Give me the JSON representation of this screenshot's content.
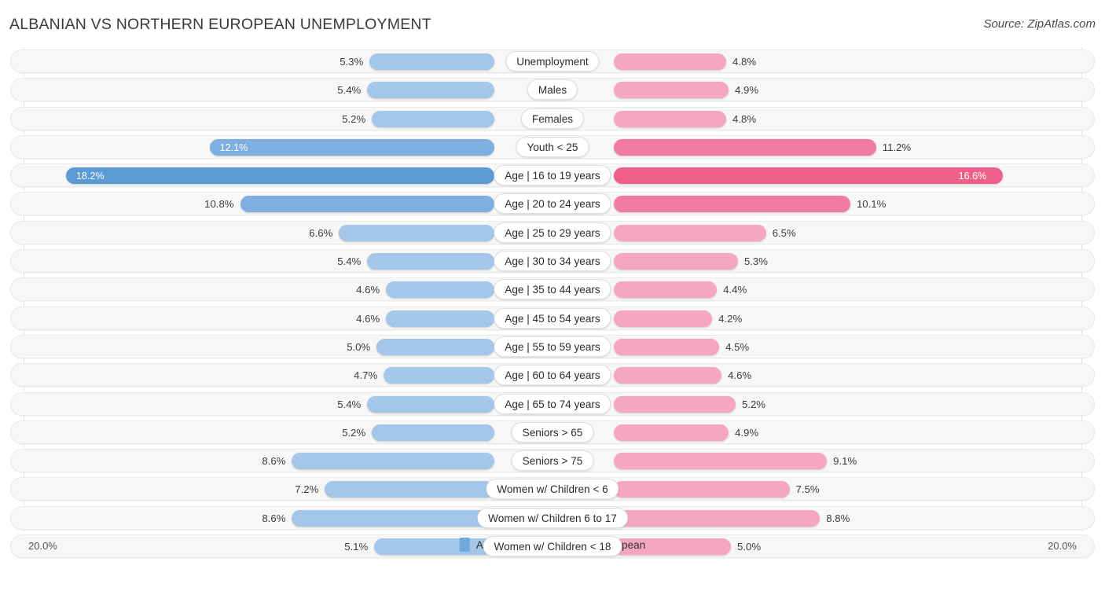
{
  "header": {
    "title": "ALBANIAN VS NORTHERN EUROPEAN UNEMPLOYMENT",
    "source": "Source: ZipAtlas.com"
  },
  "axis": {
    "left_label": "20.0%",
    "right_label": "20.0%",
    "max": 20.0
  },
  "legend": {
    "items": [
      {
        "label": "Albanian",
        "color": "#6fa8dc"
      },
      {
        "label": "Northern European",
        "color": "#ef5f8c"
      }
    ]
  },
  "colors": {
    "blue_light": "#a3c6e9",
    "blue_mid": "#7faee0",
    "blue_dark": "#5b9bd5",
    "pink_light": "#f6a6c0",
    "pink_mid": "#f27ba5",
    "pink_dark": "#ef5f8c",
    "track_bg": "#f7f7f7",
    "track_border": "#e9e9e9",
    "grid": "#e2e2e2"
  },
  "chart_data": {
    "type": "bar",
    "title": "ALBANIAN VS NORTHERN EUROPEAN UNEMPLOYMENT",
    "subtitle": "",
    "xlabel": "",
    "ylabel": "",
    "orientation": "horizontal-diverging",
    "unit": "%",
    "xlim": [
      0,
      20.0
    ],
    "grid": true,
    "legend_position": "bottom-center",
    "categories": [
      "Unemployment",
      "Males",
      "Females",
      "Youth < 25",
      "Age | 16 to 19 years",
      "Age | 20 to 24 years",
      "Age | 25 to 29 years",
      "Age | 30 to 34 years",
      "Age | 35 to 44 years",
      "Age | 45 to 54 years",
      "Age | 55 to 59 years",
      "Age | 60 to 64 years",
      "Age | 65 to 74 years",
      "Seniors > 65",
      "Seniors > 75",
      "Women w/ Children < 6",
      "Women w/ Children 6 to 17",
      "Women w/ Children < 18"
    ],
    "series": [
      {
        "name": "Albanian",
        "values": [
          5.3,
          5.4,
          5.2,
          12.1,
          18.2,
          10.8,
          6.6,
          5.4,
          4.6,
          4.6,
          5.0,
          4.7,
          5.4,
          5.2,
          8.6,
          7.2,
          8.6,
          5.1
        ]
      },
      {
        "name": "Northern European",
        "values": [
          4.8,
          4.9,
          4.8,
          11.2,
          16.6,
          10.1,
          6.5,
          5.3,
          4.4,
          4.2,
          4.5,
          4.6,
          5.2,
          4.9,
          9.1,
          7.5,
          8.8,
          5.0
        ]
      }
    ]
  },
  "rows": [
    {
      "label": "Unemployment",
      "left": "5.3%",
      "right": "4.8%",
      "lv": 5.3,
      "rv": 4.8,
      "shade": "light",
      "left_inside": false,
      "right_inside": false
    },
    {
      "label": "Males",
      "left": "5.4%",
      "right": "4.9%",
      "lv": 5.4,
      "rv": 4.9,
      "shade": "light",
      "left_inside": false,
      "right_inside": false
    },
    {
      "label": "Females",
      "left": "5.2%",
      "right": "4.8%",
      "lv": 5.2,
      "rv": 4.8,
      "shade": "light",
      "left_inside": false,
      "right_inside": false
    },
    {
      "label": "Youth < 25",
      "left": "12.1%",
      "right": "11.2%",
      "lv": 12.1,
      "rv": 11.2,
      "shade": "mid",
      "left_inside": true,
      "right_inside": false
    },
    {
      "label": "Age | 16 to 19 years",
      "left": "18.2%",
      "right": "16.6%",
      "lv": 18.2,
      "rv": 16.6,
      "shade": "dark",
      "left_inside": true,
      "right_inside": true
    },
    {
      "label": "Age | 20 to 24 years",
      "left": "10.8%",
      "right": "10.1%",
      "lv": 10.8,
      "rv": 10.1,
      "shade": "mid",
      "left_inside": false,
      "right_inside": false
    },
    {
      "label": "Age | 25 to 29 years",
      "left": "6.6%",
      "right": "6.5%",
      "lv": 6.6,
      "rv": 6.5,
      "shade": "light",
      "left_inside": false,
      "right_inside": false
    },
    {
      "label": "Age | 30 to 34 years",
      "left": "5.4%",
      "right": "5.3%",
      "lv": 5.4,
      "rv": 5.3,
      "shade": "light",
      "left_inside": false,
      "right_inside": false
    },
    {
      "label": "Age | 35 to 44 years",
      "left": "4.6%",
      "right": "4.4%",
      "lv": 4.6,
      "rv": 4.4,
      "shade": "light",
      "left_inside": false,
      "right_inside": false
    },
    {
      "label": "Age | 45 to 54 years",
      "left": "4.6%",
      "right": "4.2%",
      "lv": 4.6,
      "rv": 4.2,
      "shade": "light",
      "left_inside": false,
      "right_inside": false
    },
    {
      "label": "Age | 55 to 59 years",
      "left": "5.0%",
      "right": "4.5%",
      "lv": 5.0,
      "rv": 4.5,
      "shade": "light",
      "left_inside": false,
      "right_inside": false
    },
    {
      "label": "Age | 60 to 64 years",
      "left": "4.7%",
      "right": "4.6%",
      "lv": 4.7,
      "rv": 4.6,
      "shade": "light",
      "left_inside": false,
      "right_inside": false
    },
    {
      "label": "Age | 65 to 74 years",
      "left": "5.4%",
      "right": "5.2%",
      "lv": 5.4,
      "rv": 5.2,
      "shade": "light",
      "left_inside": false,
      "right_inside": false
    },
    {
      "label": "Seniors > 65",
      "left": "5.2%",
      "right": "4.9%",
      "lv": 5.2,
      "rv": 4.9,
      "shade": "light",
      "left_inside": false,
      "right_inside": false
    },
    {
      "label": "Seniors > 75",
      "left": "8.6%",
      "right": "9.1%",
      "lv": 8.6,
      "rv": 9.1,
      "shade": "light",
      "left_inside": false,
      "right_inside": false
    },
    {
      "label": "Women w/ Children < 6",
      "left": "7.2%",
      "right": "7.5%",
      "lv": 7.2,
      "rv": 7.5,
      "shade": "light",
      "left_inside": false,
      "right_inside": false
    },
    {
      "label": "Women w/ Children 6 to 17",
      "left": "8.6%",
      "right": "8.8%",
      "lv": 8.6,
      "rv": 8.8,
      "shade": "light",
      "left_inside": false,
      "right_inside": false
    },
    {
      "label": "Women w/ Children < 18",
      "left": "5.1%",
      "right": "5.0%",
      "lv": 5.1,
      "rv": 5.0,
      "shade": "light",
      "left_inside": false,
      "right_inside": false
    }
  ]
}
